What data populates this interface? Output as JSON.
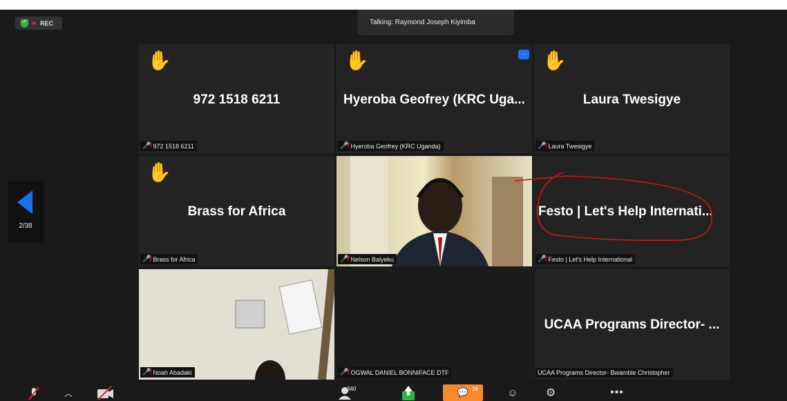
{
  "recording": {
    "label": "REC"
  },
  "talking": {
    "text": "Talking: Raymond Joseph Kiyimba"
  },
  "tiles": [
    {
      "title": "972 1518 6211",
      "name": "972 1518 6211"
    },
    {
      "title": "Hyeroba Geofrey (KRC Uga...",
      "name": "Hyeroba Geofrey (KRC Uganda)",
      "more": "..."
    },
    {
      "title": "Laura Twesigye",
      "name": "Laura Twesigye"
    },
    {
      "title": "Brass for Africa",
      "name": "Brass for Africa"
    },
    {
      "name": "Nelson Balyeku"
    },
    {
      "title": "Festo | Let's Help Internati...",
      "name": "Festo | Let's Help International"
    },
    {
      "name": "Noah Abadaki"
    },
    {
      "name": "OGWAL DANIEL BONNIFACE DTF"
    },
    {
      "title": "UCAA Programs Director- ...",
      "name": "UCAA Programs Director- Bwamble Christopher"
    }
  ],
  "pagination": {
    "page": "2/38"
  },
  "toolbar": {
    "participants_count": "340",
    "chat_count": "16",
    "more": "•••"
  },
  "icons": [
    "shield-icon",
    "raise-hand-icon",
    "mic-off-icon",
    "arrow-left-icon",
    "mic-icon",
    "video-off-icon",
    "participants-icon",
    "share-icon",
    "chat-icon",
    "reactions-icon",
    "settings-icon",
    "more-icon"
  ],
  "colors": {
    "accent": "#1d6ff2",
    "record": "#e5242a",
    "share": "#2fb34a",
    "chat": "#f58a2b",
    "annotation": "#d21414"
  }
}
